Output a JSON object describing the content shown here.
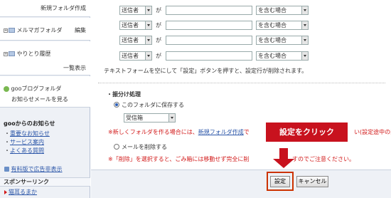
{
  "sidebar": {
    "new_folder_link": "新規フォルダ作成",
    "mailmag_folder": "メルマガフォルダ",
    "edit_link": "編集",
    "history_folder": "やりとり履歴",
    "list_link": "一覧表示",
    "blog_folder": "gooブログフォルダ",
    "blog_notice": "お知らせメールを見る",
    "news_title": "gooからのお知らせ",
    "news_items": [
      "重要なお知らせ",
      "サービス案内",
      "よくある質問"
    ],
    "adfree_label": "有料版で広告非表示",
    "sponsor_title": "スポンサーリンク",
    "sponsor_link": "猫耳るまか"
  },
  "filter": {
    "rows": [
      {
        "field": "送信者",
        "ga": "が",
        "value": "",
        "condition": "を含む場合"
      },
      {
        "field": "送信者",
        "ga": "が",
        "value": "",
        "condition": "を含む場合"
      },
      {
        "field": "送信者",
        "ga": "が",
        "value": "",
        "condition": "を含む場合"
      },
      {
        "field": "送信者",
        "ga": "が",
        "value": "",
        "condition": "を含む場合"
      }
    ],
    "hint": "テキストフォームを空にして「設定」ボタンを押すと、設定行が削除されます。"
  },
  "sort": {
    "section_title": "振分け処理",
    "save_option": "このフォルダに保存する",
    "folder_select": "受信箱",
    "note1_pre": "※新しくフォルダを作る場合には、",
    "note1_link": "新規フォルダ作成",
    "note1_post": "で",
    "note1_tail": "い(設定途中の内",
    "delete_option": "メールを削除する",
    "note2_pre": "※「削除」を選択すると、ごみ箱には移動せず完全に削",
    "note2_post": "すのでご注意ください。"
  },
  "buttons": {
    "save": "設定",
    "cancel": "キャンセル"
  },
  "callout": {
    "text": "設定をクリック"
  }
}
